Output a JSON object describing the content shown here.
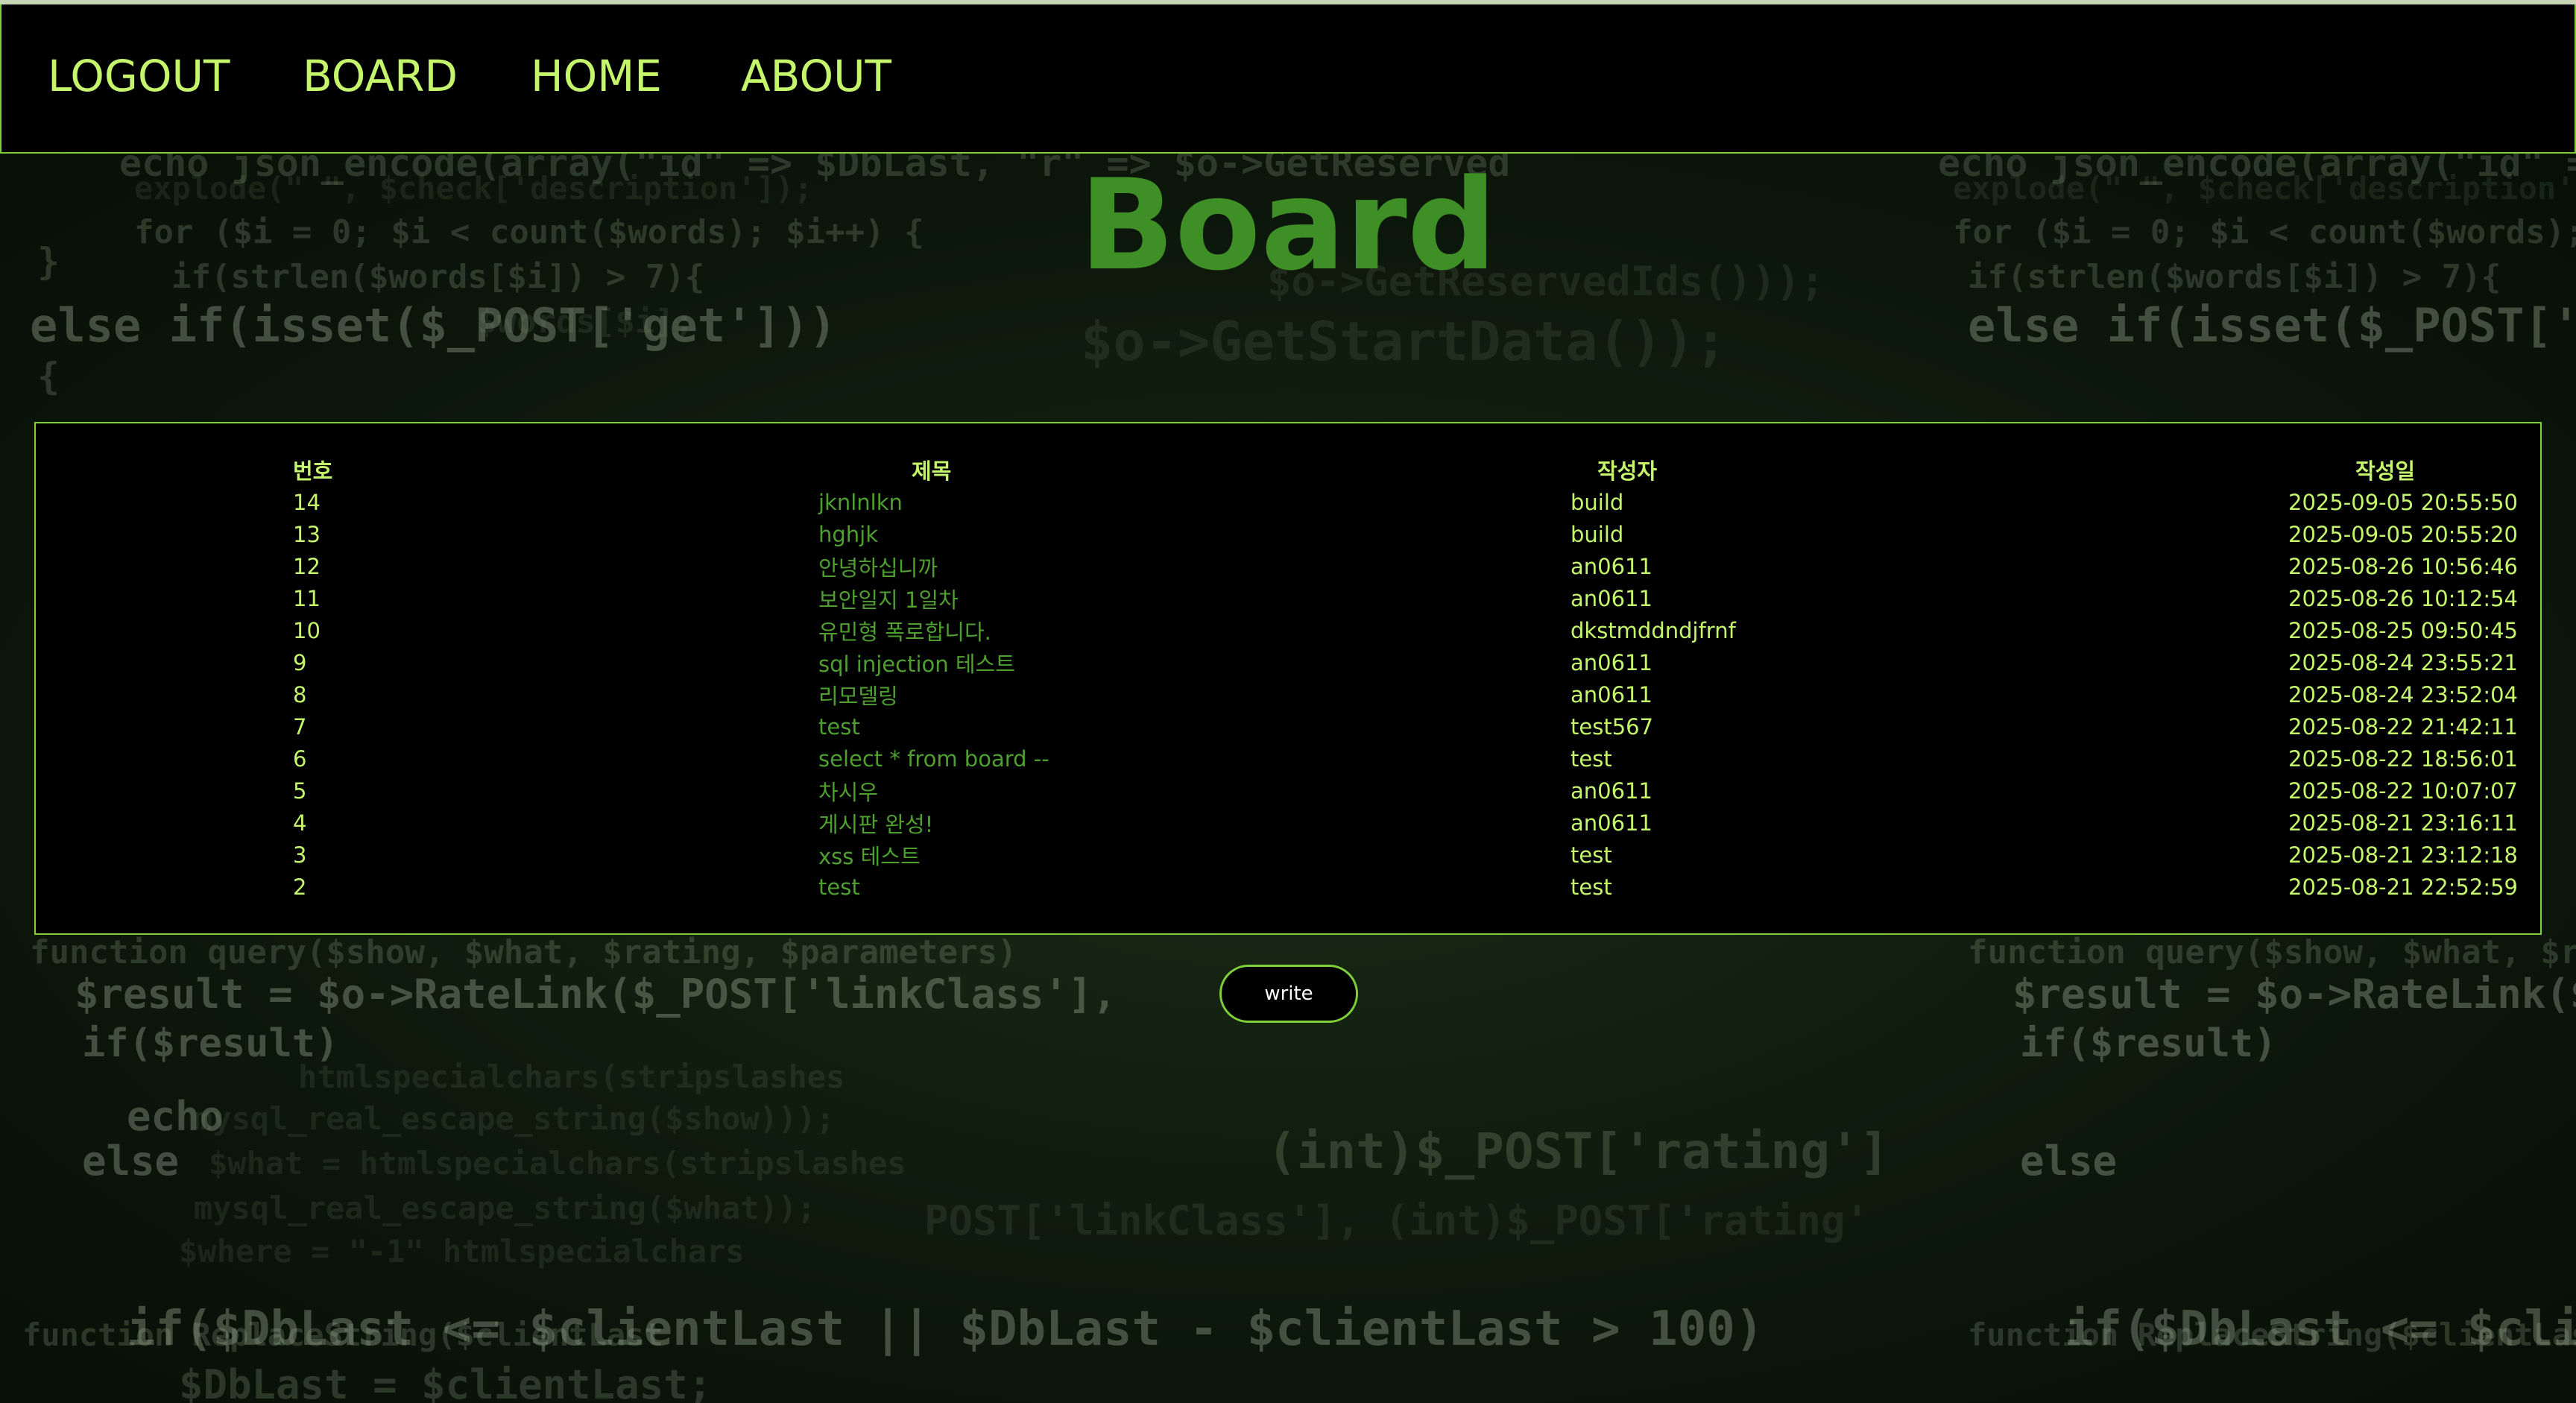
{
  "nav": {
    "items": [
      {
        "label": "LOGOUT"
      },
      {
        "label": "BOARD"
      },
      {
        "label": "HOME"
      },
      {
        "label": "ABOUT"
      }
    ]
  },
  "page": {
    "title": "Board"
  },
  "board": {
    "headers": {
      "number": "번호",
      "title": "제목",
      "author": "작성자",
      "date": "작성일"
    },
    "rows": [
      {
        "number": "14",
        "title": "jknlnlkn",
        "author": "build",
        "date": "2025-09-05 20:55:50"
      },
      {
        "number": "13",
        "title": "hghjk",
        "author": "build",
        "date": "2025-09-05 20:55:20"
      },
      {
        "number": "12",
        "title": "안녕하십니까",
        "author": "an0611",
        "date": "2025-08-26 10:56:46"
      },
      {
        "number": "11",
        "title": "보안일지 1일차",
        "author": "an0611",
        "date": "2025-08-26 10:12:54"
      },
      {
        "number": "10",
        "title": "유민형 폭로합니다.",
        "author": "dkstmddndjfrnf",
        "date": "2025-08-25 09:50:45"
      },
      {
        "number": "9",
        "title": "sql injection 테스트",
        "author": "an0611",
        "date": "2025-08-24 23:55:21"
      },
      {
        "number": "8",
        "title": "리모델링",
        "author": "an0611",
        "date": "2025-08-24 23:52:04"
      },
      {
        "number": "7",
        "title": "test",
        "author": "test567",
        "date": "2025-08-22 21:42:11"
      },
      {
        "number": "6",
        "title": "select * from board --",
        "author": "test",
        "date": "2025-08-22 18:56:01"
      },
      {
        "number": "5",
        "title": "차시우",
        "author": "an0611",
        "date": "2025-08-22 10:07:07"
      },
      {
        "number": "4",
        "title": "게시판 완성!",
        "author": "an0611",
        "date": "2025-08-21 23:16:11"
      },
      {
        "number": "3",
        "title": "xss 테스트",
        "author": "test",
        "date": "2025-08-21 23:12:18"
      },
      {
        "number": "2",
        "title": "test",
        "author": "test",
        "date": "2025-08-21 22:52:59"
      }
    ]
  },
  "actions": {
    "write_label": "write"
  },
  "background": {
    "code_lines": [
      "echo json_encode(array(\"id\" => $DbLast, \"r\" => $o->GetReserved",
      "explode(\" \", $check['description']);",
      "for ($i = 0; $i < count($words); $i++) {",
      "}",
      "if(strlen($words[$i]) > 7){",
      "else if(isset($_POST['get']))",
      "$words[$i];",
      "{",
      "$o->GetStartData());",
      "function query($show, $what, $rating, $parameters)",
      "$result = $o->RateLink($_POST['linkClass'],",
      "if($result)",
      "htmlspecialchars(stripslashes",
      "echo",
      "mysql_real_escape_string($show)));",
      "else",
      "$what = htmlspecialchars(stripslashes",
      "mysql_real_escape_string($what));",
      "$where = \"-1\" htmlspecialchars",
      "(int)$_POST['rating']",
      "POST['linkClass'], (int)$_POST['rating'",
      "function ReplaceString($clientLast",
      "if($DbLast <= $clientLast || $DbLast - $clientLast > 100)",
      "$DbLast = $clientLast;",
      "$o->GetReservedIds()));"
    ]
  },
  "colors": {
    "accent": "#c4f56a",
    "title_green": "#3e8f25",
    "link_green": "#4e9f30",
    "border": "#7fcf3a",
    "panel": "#000000"
  }
}
